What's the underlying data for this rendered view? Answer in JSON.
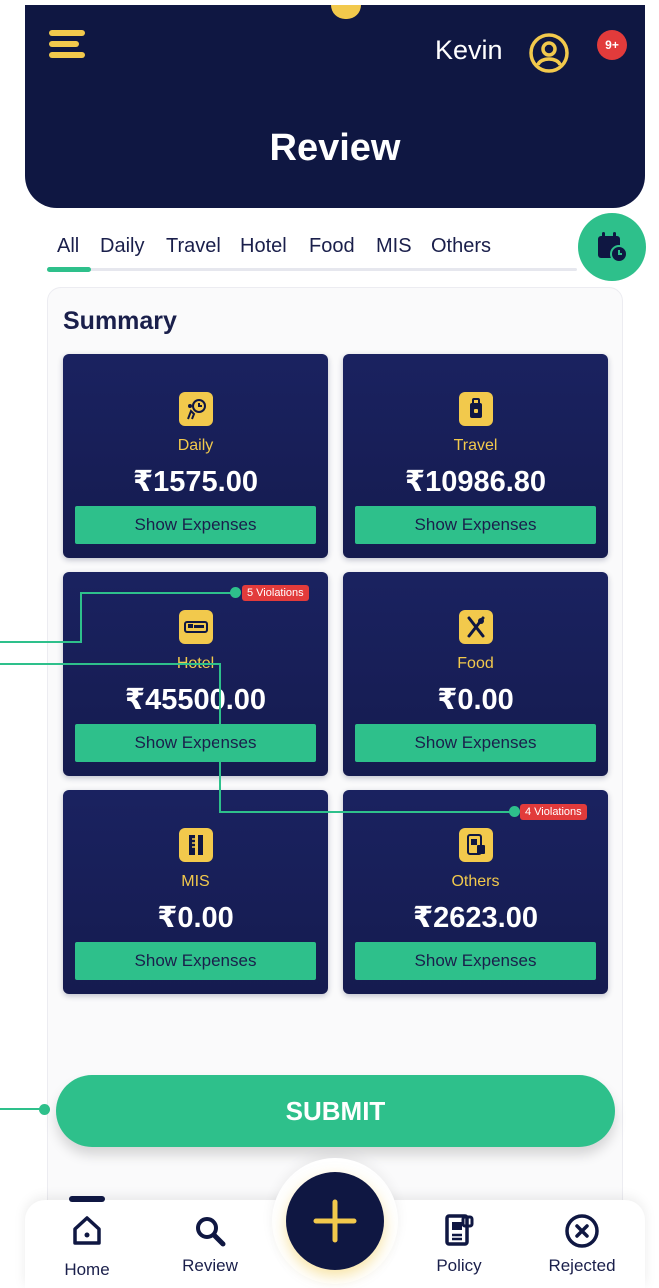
{
  "header": {
    "user_name": "Kevin",
    "notifications": "9+",
    "title": "Review"
  },
  "tabs": [
    "All",
    "Daily",
    "Travel",
    "Hotel",
    "Food",
    "MIS",
    "Others"
  ],
  "active_tab": "All",
  "summary": {
    "title": "Summary",
    "cards": [
      {
        "label": "Daily",
        "amount": "₹1575.00",
        "button": "Show Expenses",
        "icon": "daily-clock-icon"
      },
      {
        "label": "Travel",
        "amount": "₹10986.80",
        "button": "Show Expenses",
        "icon": "luggage-icon"
      },
      {
        "label": "Hotel",
        "amount": "₹45500.00",
        "button": "Show Expenses",
        "icon": "bed-icon",
        "violations": "5 Violations"
      },
      {
        "label": "Food",
        "amount": "₹0.00",
        "button": "Show Expenses",
        "icon": "fork-knife-icon"
      },
      {
        "label": "MIS",
        "amount": "₹0.00",
        "button": "Show Expenses",
        "icon": "ruler-icon"
      },
      {
        "label": "Others",
        "amount": "₹2623.00",
        "button": "Show Expenses",
        "icon": "document-icon",
        "violations": "4 Violations"
      }
    ]
  },
  "submit_label": "SUBMIT",
  "bottom_nav": [
    {
      "label": "Home",
      "icon": "home-icon"
    },
    {
      "label": "Review",
      "icon": "search-icon"
    },
    {
      "label": "Policy",
      "icon": "policy-icon"
    },
    {
      "label": "Rejected",
      "icon": "close-circle-icon"
    }
  ],
  "colors": {
    "navy": "#0f1742",
    "accent_green": "#2ec08b",
    "accent_yellow": "#f2c94c",
    "violation_red": "#e23b3b"
  }
}
